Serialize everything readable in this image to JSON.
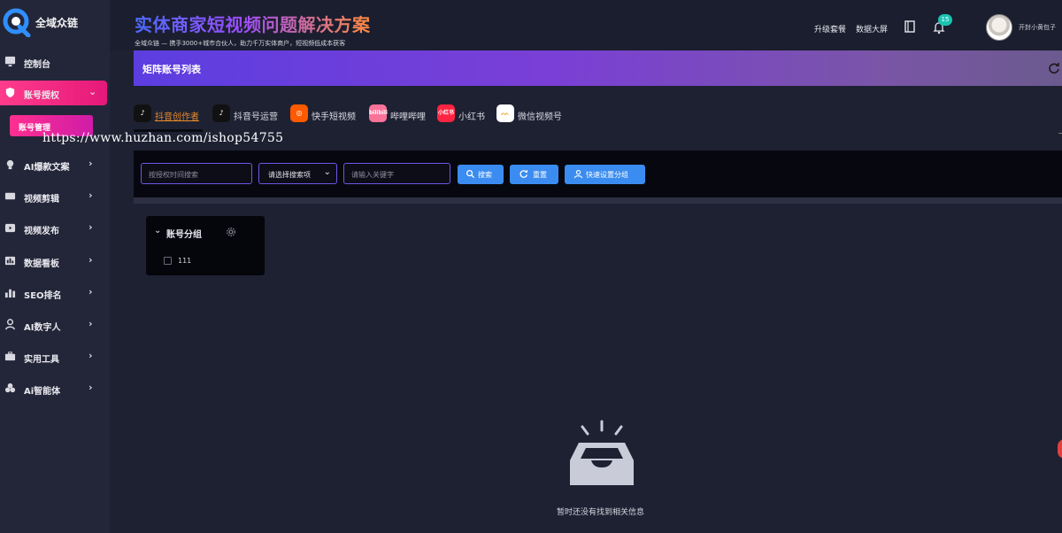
{
  "brand": {
    "name": "全域众链"
  },
  "header": {
    "title": "实体商家短视频问题解决方案",
    "subtitle": "全域众链 — 携手3000+城市合伙人，助力千万实体商户，短视频低成本获客",
    "links": [
      "升级套餐",
      "数据大屏"
    ],
    "notification_count": "15",
    "username": "开封小黄包子"
  },
  "sidebar": {
    "items": [
      {
        "label": "控制台",
        "icon": "monitor-icon"
      },
      {
        "label": "账号授权",
        "icon": "shield-icon",
        "active": true
      },
      {
        "label": "AI爆款文案",
        "icon": "bulb-icon"
      },
      {
        "label": "视频剪辑",
        "icon": "scissors-icon"
      },
      {
        "label": "视频发布",
        "icon": "play-icon"
      },
      {
        "label": "数据看板",
        "icon": "dashboard-icon"
      },
      {
        "label": "SEO排名",
        "icon": "bar-chart-icon"
      },
      {
        "label": "AI数字人",
        "icon": "person-icon"
      },
      {
        "label": "实用工具",
        "icon": "toolbox-icon"
      },
      {
        "label": "Ai智能体",
        "icon": "agent-icon"
      }
    ],
    "subitem": "账号管理"
  },
  "page": {
    "title": "矩阵账号列表"
  },
  "tabs": [
    {
      "label": "抖音创作者",
      "icon": "douyin-icon",
      "active": true
    },
    {
      "label": "抖音号运营",
      "icon": "douyin-icon"
    },
    {
      "label": "快手短视频",
      "icon": "kuaishou-icon"
    },
    {
      "label": "哔哩哔哩",
      "icon": "bilibili-icon",
      "icon_text": "bilibili"
    },
    {
      "label": "小红书",
      "icon": "xiaohongshu-icon",
      "icon_text": "小红书"
    },
    {
      "label": "微信视频号",
      "icon": "wechat-channels-icon"
    }
  ],
  "watermark": "https://www.huzhan.com/ishop54755",
  "search": {
    "time_placeholder": "按授权时间搜索",
    "select_value": "请选择搜索项",
    "keyword_placeholder": "请输入关键字",
    "search_label": "搜索",
    "reset_label": "重置",
    "group_label": "快速设置分组"
  },
  "groups": {
    "title": "账号分组",
    "items": [
      "111"
    ]
  },
  "empty": {
    "message": "暂时还没有找到相关信息"
  },
  "colors": {
    "accent_pink": "#ff3c8c",
    "accent_purple": "#5c3ee0",
    "button_blue": "#3b8cf0",
    "active_tab": "#e88a2a"
  }
}
